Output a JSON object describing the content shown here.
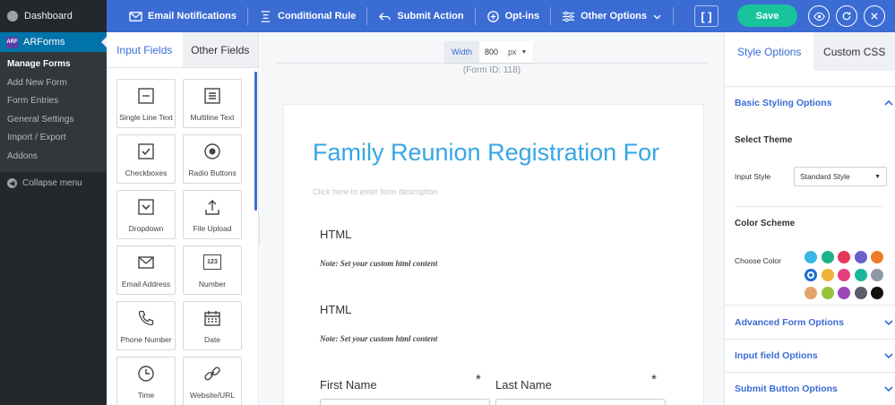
{
  "wp_sidebar": {
    "dashboard": "Dashboard",
    "plugin": "ARForms",
    "plugin_logo": "ARF",
    "submenu": [
      "Manage Forms",
      "Add New Form",
      "Form Entries",
      "General Settings",
      "Import / Export",
      "Addons"
    ],
    "collapse": "Collapse menu"
  },
  "toolbar": {
    "email_notifications": "Email Notifications",
    "conditional_rule": "Conditional Rule",
    "submit_action": "Submit Action",
    "opt_ins": "Opt-ins",
    "other_options": "Other Options",
    "brackets": "[ ]",
    "save": "Save"
  },
  "left_panel": {
    "tabs": [
      "Input Fields",
      "Other Fields"
    ],
    "fields": [
      {
        "label": "Single Line Text",
        "icon": "single-line-icon"
      },
      {
        "label": "Multiline Text",
        "icon": "multiline-icon"
      },
      {
        "label": "Checkboxes",
        "icon": "checkbox-icon"
      },
      {
        "label": "Radio Buttons",
        "icon": "radio-icon"
      },
      {
        "label": "Dropdown",
        "icon": "dropdown-icon"
      },
      {
        "label": "File Upload",
        "icon": "upload-icon"
      },
      {
        "label": "Email Address",
        "icon": "envelope-icon"
      },
      {
        "label": "Number",
        "icon": "number-icon"
      },
      {
        "label": "Phone Number",
        "icon": "phone-icon"
      },
      {
        "label": "Date",
        "icon": "calendar-icon"
      },
      {
        "label": "Time",
        "icon": "clock-icon"
      },
      {
        "label": "Website/URL",
        "icon": "link-icon"
      }
    ],
    "number_icon_text": "123"
  },
  "canvas": {
    "width_label": "Width",
    "width_value": "800",
    "width_unit": "px",
    "form_id": "(Form ID: 118)",
    "form_title": "Family Reunion Registration For",
    "form_description": "Click here to enter form description",
    "html_blocks": [
      {
        "label": "HTML",
        "note": "Note: Set your custom html content"
      },
      {
        "label": "HTML",
        "note": "Note: Set your custom html content"
      }
    ],
    "first_name": "First Name",
    "last_name": "Last Name",
    "required_mark": "*"
  },
  "right_panel": {
    "tabs": [
      "Style Options",
      "Custom CSS"
    ],
    "basic_styling": "Basic Styling Options",
    "select_theme": "Select Theme",
    "input_style_label": "Input Style",
    "input_style_value": "Standard Style",
    "color_scheme": "Color Scheme",
    "choose_color": "Choose Color",
    "swatches": [
      "#37b7e6",
      "#1bb38a",
      "#e8375a",
      "#6a5fcf",
      "#f07c2a",
      "#1f6fd1",
      "#f2b134",
      "#e53f7d",
      "#1ab79b",
      "#8e98a6",
      "#e1a46b",
      "#97c43b",
      "#9c48b9",
      "#5a5f6b",
      "#111111"
    ],
    "advanced_form": "Advanced Form Options",
    "input_field": "Input field Options",
    "submit_button": "Submit Button Options"
  },
  "colors": {
    "accent": "#3b6cd4",
    "save": "#19c39b",
    "title": "#37a6e6"
  }
}
